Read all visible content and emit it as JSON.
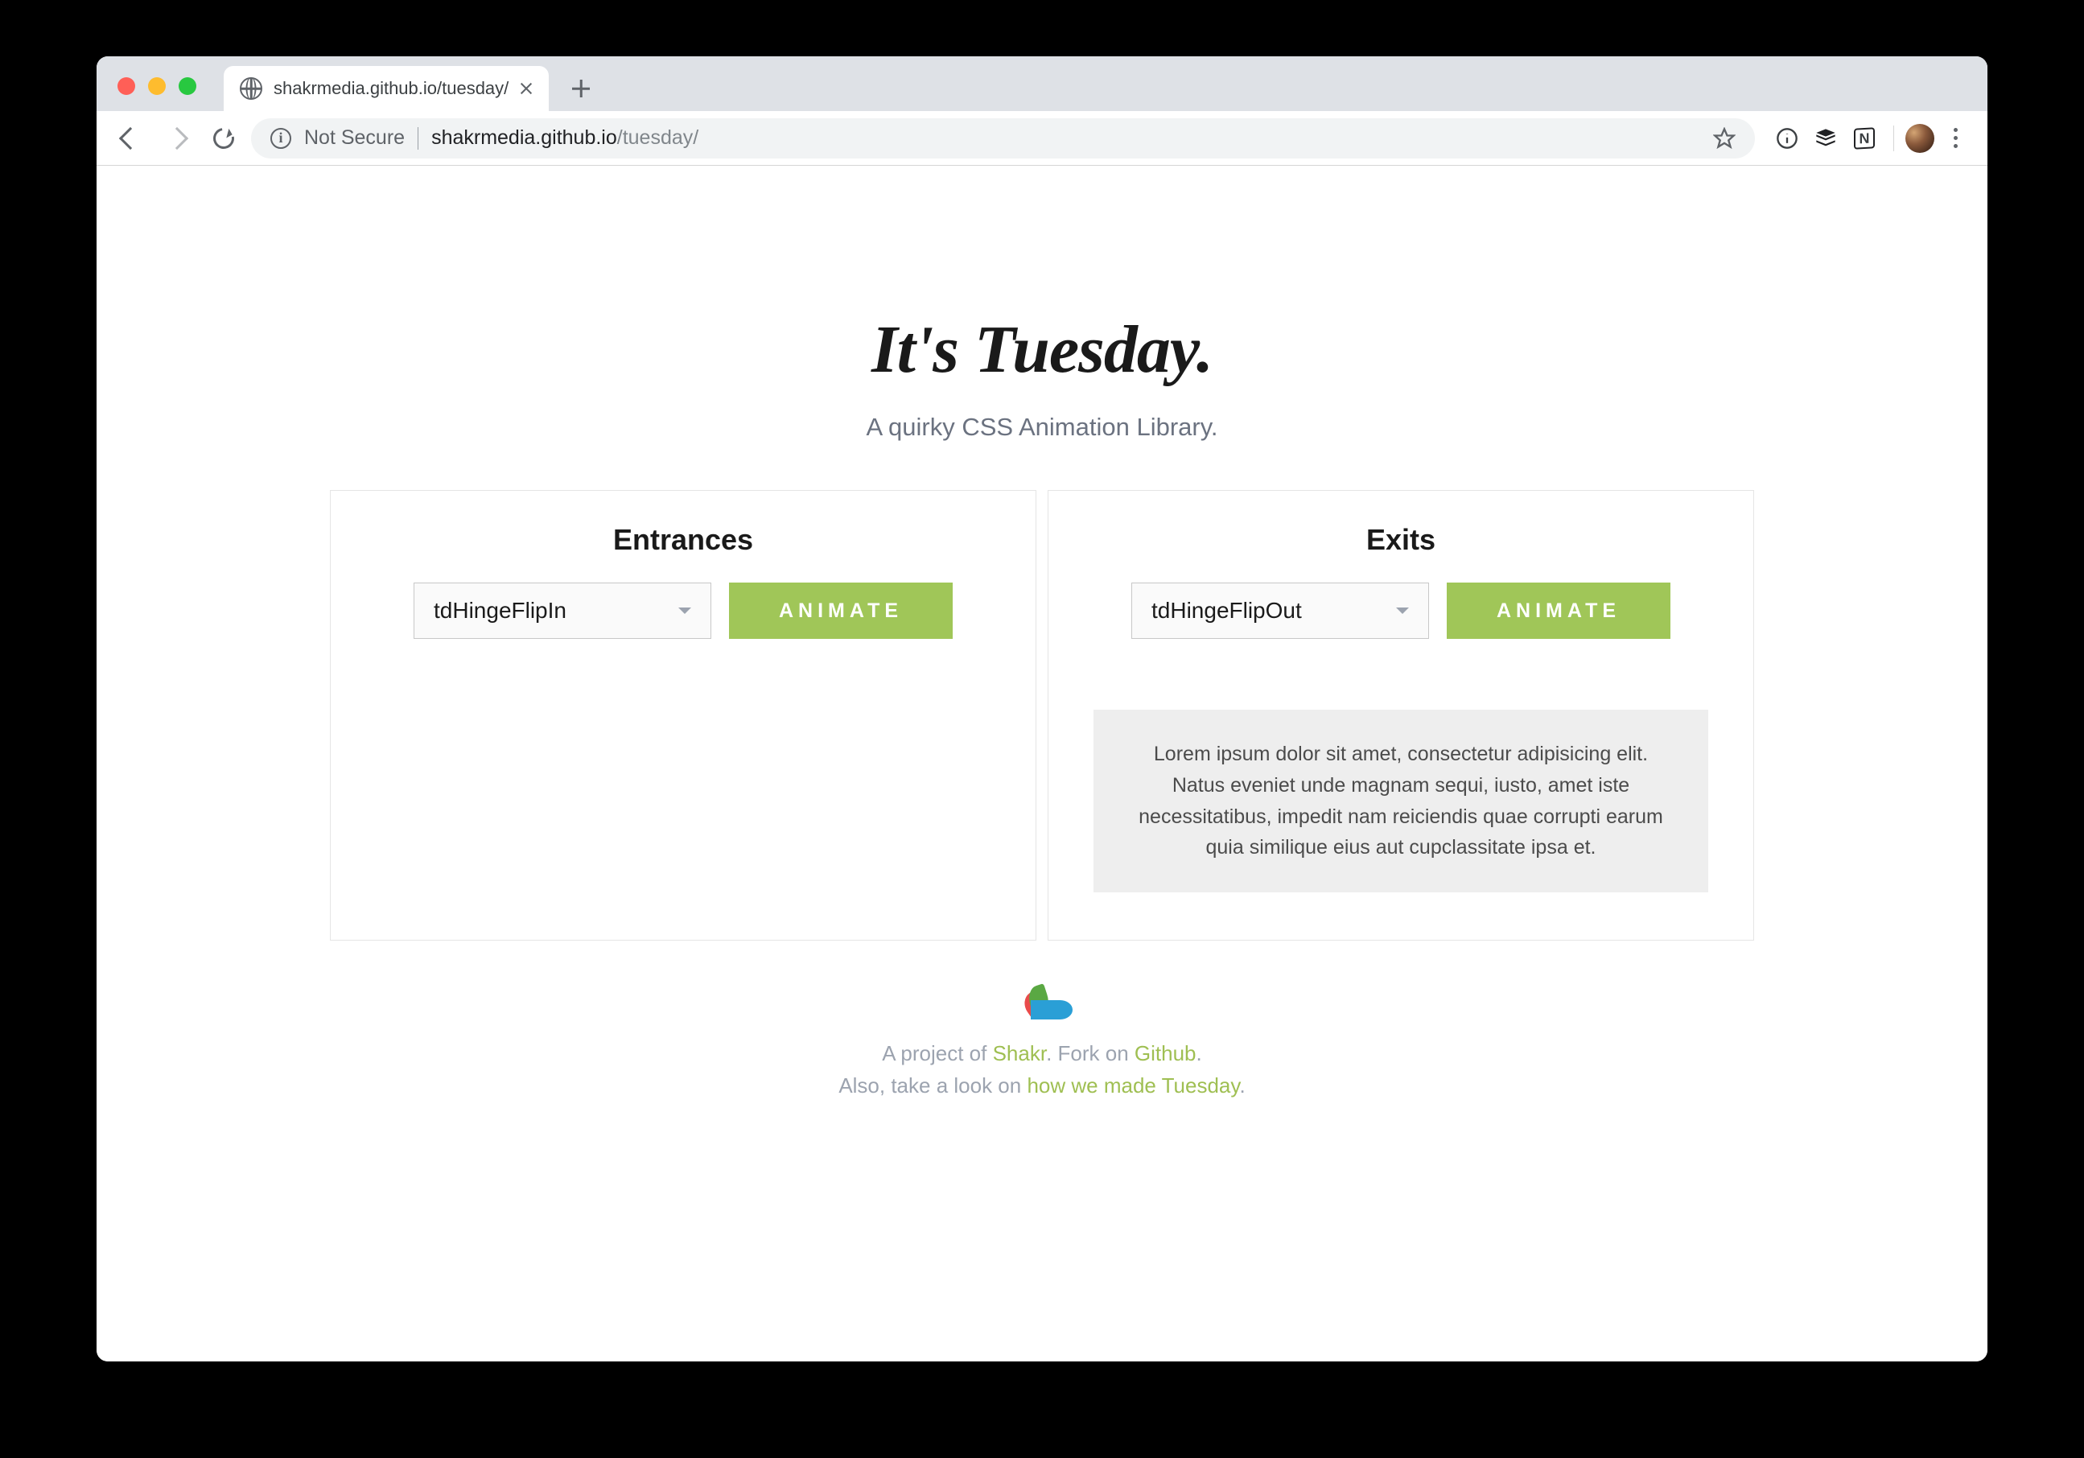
{
  "browser": {
    "tab_title": "shakrmedia.github.io/tuesday/",
    "not_secure_label": "Not Secure",
    "url_domain": "shakrmedia.github.io",
    "url_path": "/tuesday/",
    "notion_glyph": "N"
  },
  "page": {
    "title": "It's Tuesday.",
    "subtitle": "A quirky CSS Animation Library."
  },
  "panels": {
    "entrances": {
      "title": "Entrances",
      "selected": "tdHingeFlipIn",
      "button": "ANIMATE"
    },
    "exits": {
      "title": "Exits",
      "selected": "tdHingeFlipOut",
      "button": "ANIMATE",
      "demo_text": "Lorem ipsum dolor sit amet, consectetur adipisicing elit. Natus eveniet unde magnam sequi, iusto, amet iste necessitatibus, impedit nam reiciendis quae corrupti earum quia similique eius aut cupclassitate ipsa et."
    }
  },
  "footer": {
    "line1_pre": "A project of ",
    "line1_link1": "Shakr",
    "line1_mid": ". Fork on ",
    "line1_link2": "Github",
    "line1_post": ".",
    "line2_pre": "Also, take a look on ",
    "line2_link": "how we made Tuesday",
    "line2_post": "."
  }
}
